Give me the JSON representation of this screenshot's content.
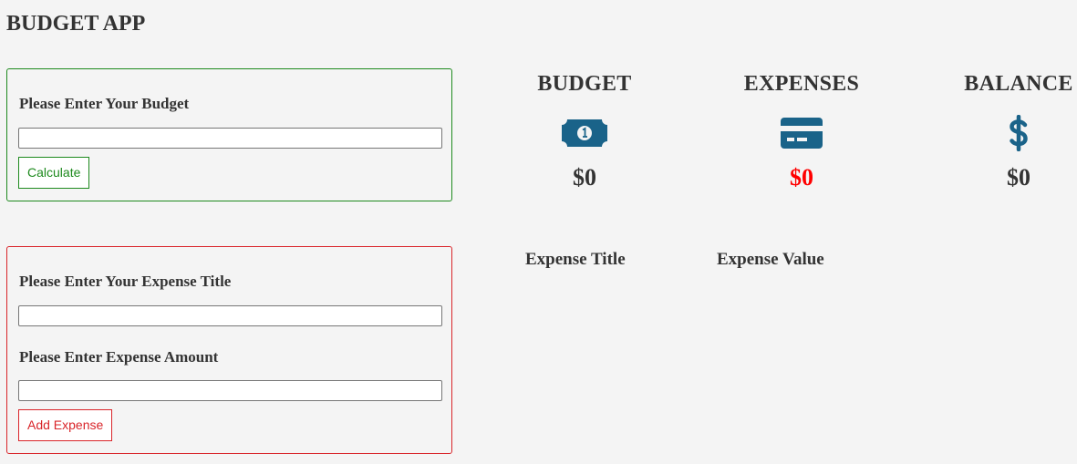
{
  "app": {
    "title": "BUDGET APP"
  },
  "budget_form": {
    "label": "Please Enter Your Budget",
    "input_value": "",
    "button_label": "Calculate"
  },
  "expense_form": {
    "title_label": "Please Enter Your Expense Title",
    "title_value": "",
    "amount_label": "Please Enter Expense Amount",
    "amount_value": "",
    "button_label": "Add Expense"
  },
  "stats": {
    "budget": {
      "title": "BUDGET",
      "amount": "$0",
      "icon": "money-bill-icon"
    },
    "expenses": {
      "title": "EXPENSES",
      "amount": "$0",
      "icon": "credit-card-icon",
      "amount_color": "#ff0000"
    },
    "balance": {
      "title": "BALANCE",
      "amount": "$0",
      "icon": "dollar-sign-icon"
    }
  },
  "expense_list": {
    "headers": [
      "Expense Title",
      "Expense Value"
    ],
    "rows": []
  },
  "colors": {
    "background": "#f4f4f4",
    "budget_accent": "#1e8a1e",
    "expense_accent": "#d9252a",
    "icon_color": "#1a6389"
  }
}
